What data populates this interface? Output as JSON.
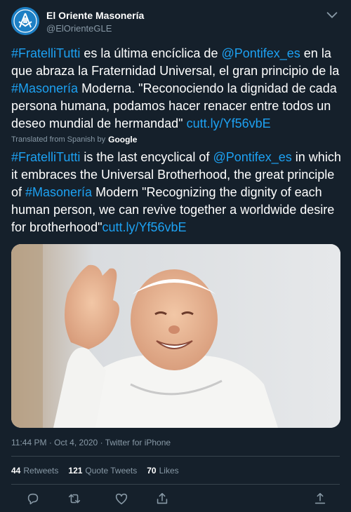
{
  "author": {
    "display_name": "El Oriente Masonería",
    "handle": "@ElOrienteGLE"
  },
  "tweet": {
    "original": [
      {
        "text": "#FratelliTutti",
        "link": true
      },
      {
        "text": " es la última encíclica de ",
        "link": false
      },
      {
        "text": "@Pontifex_es",
        "link": true
      },
      {
        "text": " en la que abraza la Fraternidad Universal, el gran principio de la ",
        "link": false
      },
      {
        "text": "#Masonería",
        "link": true
      },
      {
        "text": " Moderna. \"Reconociendo la dignidad de cada persona humana, podamos hacer renacer entre todos un deseo mundial de hermandad\" ",
        "link": false
      },
      {
        "text": "cutt.ly/Yf56vbE",
        "link": true
      }
    ],
    "translated_label": "Translated from Spanish by",
    "translator": "Google",
    "translation": [
      {
        "text": "#FratelliTutti",
        "link": true
      },
      {
        "text": " is the last encyclical of ",
        "link": false
      },
      {
        "text": "@Pontifex_es",
        "link": true
      },
      {
        "text": " in which it embraces the Universal Brotherhood, the great principle of ",
        "link": false
      },
      {
        "text": "#Masonería",
        "link": true
      },
      {
        "text": " Modern \"Recognizing the dignity of each human person, we can revive together a worldwide desire for brotherhood\"",
        "link": false
      },
      {
        "text": "cutt.ly/Yf56vbE",
        "link": true
      }
    ]
  },
  "meta": {
    "time": "11:44 PM",
    "date": "Oct 4, 2020",
    "source": "Twitter for iPhone",
    "separator": "·"
  },
  "stats": {
    "retweets_count": "44",
    "retweets_label": "Retweets",
    "quotes_count": "121",
    "quotes_label": "Quote Tweets",
    "likes_count": "70",
    "likes_label": "Likes"
  },
  "icons": {
    "avatar": "masonic-square-compass-logo",
    "more": "chevron-down-icon",
    "reply": "reply-icon",
    "retweet": "retweet-icon",
    "like": "heart-icon",
    "share": "share-icon"
  },
  "colors": {
    "background": "#15202b",
    "link": "#1da1f2",
    "muted": "#8899a6",
    "divider": "#38444d"
  }
}
